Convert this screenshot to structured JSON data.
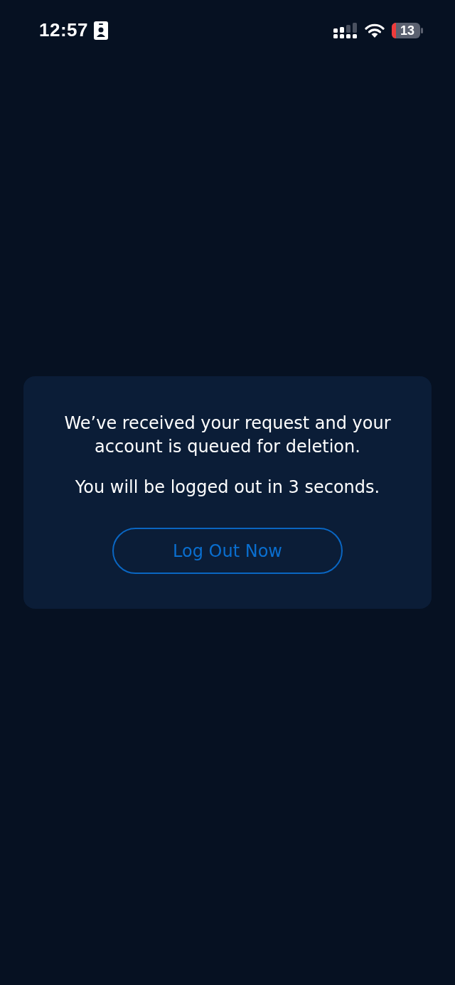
{
  "status_bar": {
    "time": "12:57",
    "battery": "13"
  },
  "dialog": {
    "messages": [
      "We’ve received your request and your account is queued for deletion.",
      "You will be logged out in 3 seconds."
    ],
    "button": "Log Out Now"
  }
}
